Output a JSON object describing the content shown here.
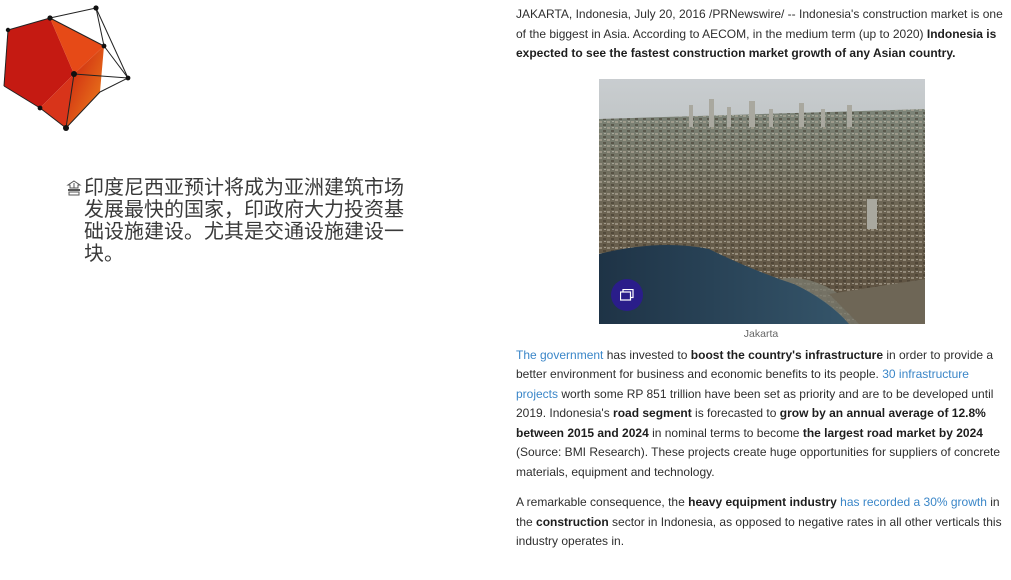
{
  "bullet": {
    "text": "印度尼西亚预计将成为亚洲建筑市场发展最快的国家，印政府大力投资基础设施建设。尤其是交通设施建设一块。"
  },
  "article": {
    "lead_1": "JAKARTA, Indonesia, July 20, 2016 /PRNewswire/ -- Indonesia's construction market is one of the biggest in Asia. According to AECOM, in the medium term (up to 2020) ",
    "lead_bold": "Indonesia is expected to see the fastest construction market growth of any Asian country.",
    "image_caption": "Jakarta",
    "p2": {
      "link_1": "The government",
      "t1": " has invested to ",
      "b1": "boost the country's infrastructure",
      "t2": " in order to provide a better environment for business and economic benefits to its people. ",
      "link_2": "30 infrastructure projects",
      "t3": " worth some RP 851 trillion have been set as priority and are to be developed until 2019. Indonesia's ",
      "b2": "road segment",
      "t4": " is forecasted to ",
      "b3": "grow by an annual average of 12.8% between 2015 and 2024",
      "t5": " in nominal terms to become ",
      "b4": "the largest road market by 2024",
      "t6": " (Source: BMI Research). These projects create huge opportunities for suppliers of concrete materials, equipment and technology."
    },
    "p3": {
      "t1": "A remarkable consequence, the ",
      "b1": "heavy equipment industry",
      "link_1": " has recorded a 30% growth",
      "t2": " in the ",
      "b2": "construction",
      "t3": " sector in Indonesia, as opposed to negative rates in all other verticals this industry operates in."
    }
  },
  "colors": {
    "link": "#3a86c8",
    "logo_red": "#d9261c",
    "logo_orange": "#f07a1a",
    "gallery_button": "#2a1d8a"
  },
  "icons": {
    "bullet": "bullet-glyph-icon",
    "gallery": "gallery-icon"
  }
}
